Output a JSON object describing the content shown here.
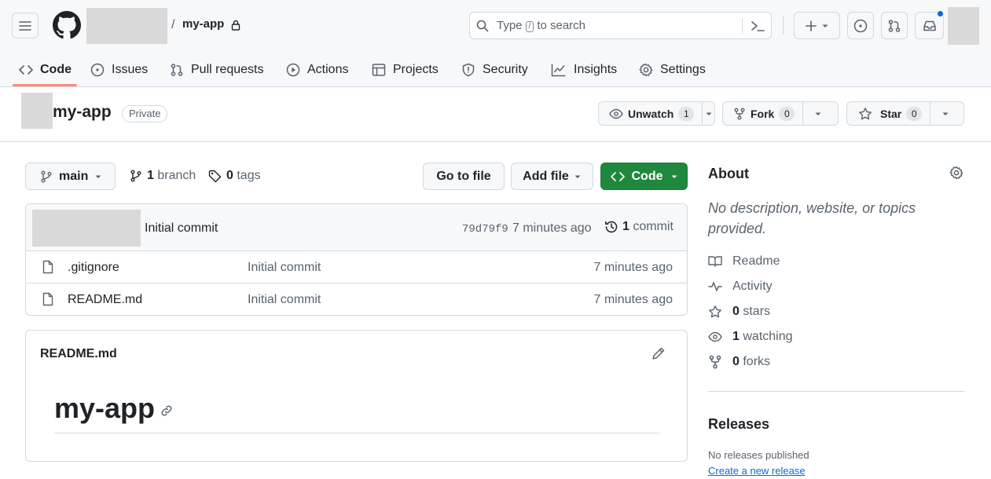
{
  "header": {
    "repo_name": "my-app",
    "slash": "/",
    "search_prefix": "Type",
    "search_key": "/",
    "search_suffix": "to search"
  },
  "nav": {
    "tabs": [
      {
        "label": "Code"
      },
      {
        "label": "Issues"
      },
      {
        "label": "Pull requests"
      },
      {
        "label": "Actions"
      },
      {
        "label": "Projects"
      },
      {
        "label": "Security"
      },
      {
        "label": "Insights"
      },
      {
        "label": "Settings"
      }
    ],
    "selected": "Code"
  },
  "repo": {
    "title": "my-app",
    "visibility": "Private",
    "watch_label": "Unwatch",
    "watch_count": "1",
    "fork_label": "Fork",
    "fork_count": "0",
    "star_label": "Star",
    "star_count": "0"
  },
  "toolbar": {
    "branch": "main",
    "branch_count": "1",
    "branch_word": "branch",
    "tag_count": "0",
    "tag_word": "tags",
    "go_to_file": "Go to file",
    "add_file": "Add file",
    "code": "Code"
  },
  "latest_commit": {
    "message": "Initial commit",
    "sha": "79d79f9",
    "time": "7 minutes ago",
    "count": "1",
    "count_word": "commit"
  },
  "files": [
    {
      "name": ".gitignore",
      "message": "Initial commit",
      "time": "7 minutes ago"
    },
    {
      "name": "README.md",
      "message": "Initial commit",
      "time": "7 minutes ago"
    }
  ],
  "readme": {
    "label": "README.md",
    "heading": "my-app"
  },
  "about": {
    "title": "About",
    "description": "No description, website, or topics provided.",
    "readme": "Readme",
    "activity": "Activity",
    "stars_count": "0",
    "stars_word": "stars",
    "watching_count": "1",
    "watching_word": "watching",
    "forks_count": "0",
    "forks_word": "forks"
  },
  "releases": {
    "title": "Releases",
    "none": "No releases published",
    "create": "Create a new release"
  },
  "colors": {
    "accent": "#0969da",
    "primary_button": "#1f883d",
    "tab_underline": "#fd8c73",
    "header_bg": "#f6f8fa"
  }
}
